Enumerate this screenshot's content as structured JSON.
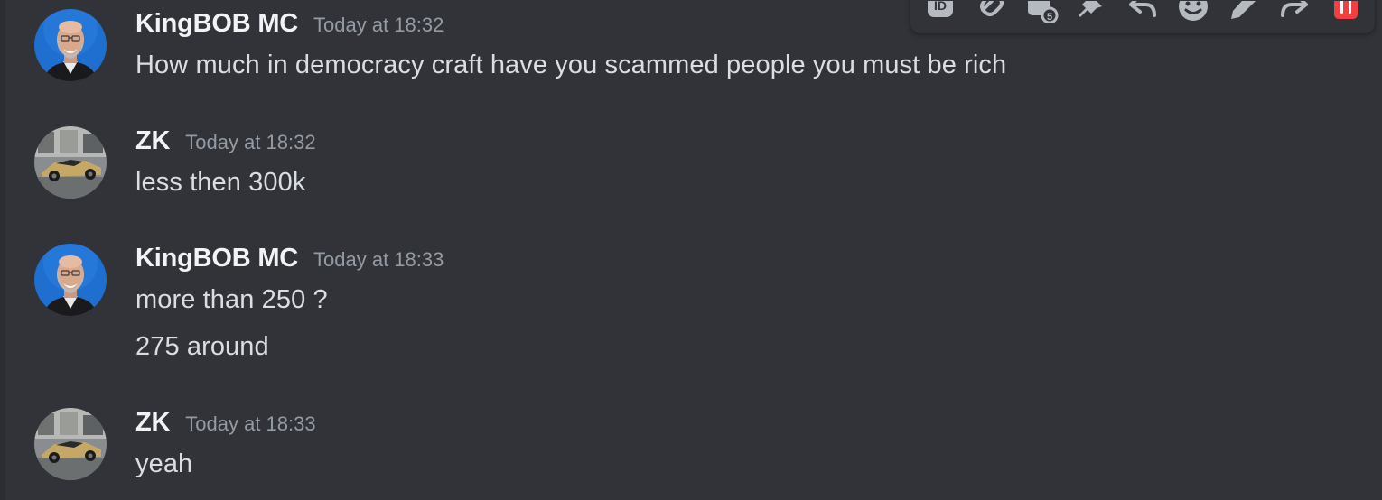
{
  "messages": [
    {
      "author": "KingBOB MC",
      "timestamp": "Today at 18:32",
      "lines": [
        "How much in democracy craft  have you scammed people you must be rich"
      ],
      "avatar": "bald-man-smiling-avatar"
    },
    {
      "author": "ZK",
      "timestamp": "Today at 18:32",
      "lines": [
        "less then 300k"
      ],
      "avatar": "gold-sports-car-avatar"
    },
    {
      "author": "KingBOB MC",
      "timestamp": "Today at 18:33",
      "lines": [
        "more than 250 ?",
        "275 around"
      ],
      "avatar": "bald-man-smiling-avatar"
    },
    {
      "author": "ZK",
      "timestamp": "Today at 18:33",
      "lines": [
        "yeah"
      ],
      "avatar": "gold-sports-car-avatar"
    }
  ],
  "toolbar": {
    "icons": [
      "copy-id-icon",
      "copy-link-icon",
      "apps-icon",
      "pin-icon",
      "reply-icon",
      "add-reaction-icon",
      "edit-icon",
      "forward-icon",
      "delete-icon"
    ]
  },
  "colors": {
    "background": "#313338",
    "text": "#dbdee1",
    "username": "#f2f3f5",
    "timestamp": "#949ba4",
    "danger": "#f23f42",
    "avatar_blue": "#1f6fd0"
  }
}
